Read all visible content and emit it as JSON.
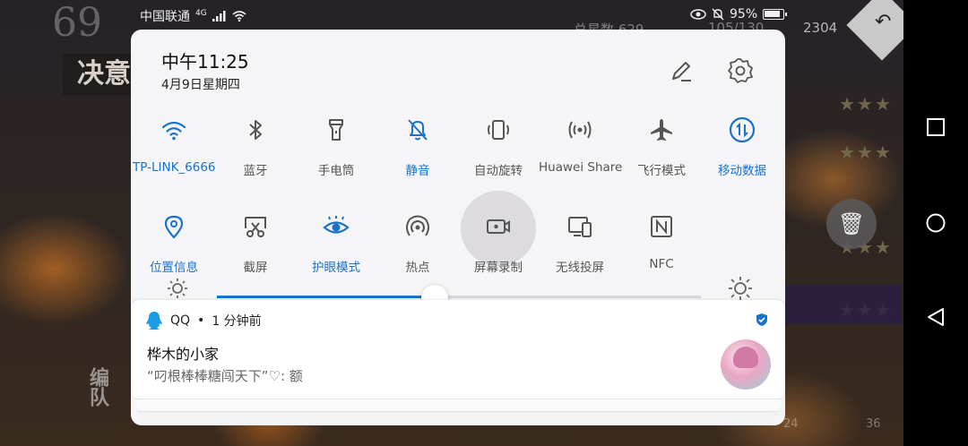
{
  "status_bar": {
    "carrier": "中国联通",
    "network": "4G",
    "battery_text": "95%"
  },
  "game": {
    "corner_number": "69",
    "banner_char": "决意",
    "stat_label": "总星数",
    "stat_value": "629",
    "stat_ratio": "105/130",
    "currency": "2304",
    "squad_label": "编队",
    "bottom_left_num": "24",
    "bottom_right_num": "36"
  },
  "panel": {
    "time": "中午11:25",
    "date": "4月9日星期四",
    "edit_icon": "pencil-icon",
    "settings_icon": "gear-icon"
  },
  "tiles": {
    "row1": [
      {
        "label": "TP-LINK_6666",
        "icon": "wifi-icon",
        "active": true
      },
      {
        "label": "蓝牙",
        "icon": "bluetooth-icon",
        "active": false
      },
      {
        "label": "手电筒",
        "icon": "flashlight-icon",
        "active": false
      },
      {
        "label": "静音",
        "icon": "bell-off-icon",
        "active": true
      },
      {
        "label": "自动旋转",
        "icon": "rotate-icon",
        "active": false
      },
      {
        "label": "Huawei Share",
        "icon": "share-wave-icon",
        "active": false
      },
      {
        "label": "飞行模式",
        "icon": "airplane-icon",
        "active": false
      },
      {
        "label": "移动数据",
        "icon": "mobile-data-icon",
        "active": true
      }
    ],
    "row2": [
      {
        "label": "位置信息",
        "icon": "location-icon",
        "active": true
      },
      {
        "label": "截屏",
        "icon": "screenshot-icon",
        "active": false
      },
      {
        "label": "护眼模式",
        "icon": "eye-icon",
        "active": true
      },
      {
        "label": "热点",
        "icon": "hotspot-icon",
        "active": false
      },
      {
        "label": "屏幕录制",
        "icon": "screen-record-icon",
        "active": false
      },
      {
        "label": "无线投屏",
        "icon": "cast-icon",
        "active": false
      },
      {
        "label": "NFC",
        "icon": "nfc-icon",
        "active": false
      }
    ]
  },
  "brightness": {
    "level_percent": 45
  },
  "notification": {
    "app": "QQ",
    "time_ago": "1 分钟前",
    "title": "桦木的小家",
    "body": "“叼根棒棒糖闯天下”♡: 额"
  },
  "colors": {
    "accent": "#1a73c9",
    "panel_bg": "#f5f5f7"
  }
}
